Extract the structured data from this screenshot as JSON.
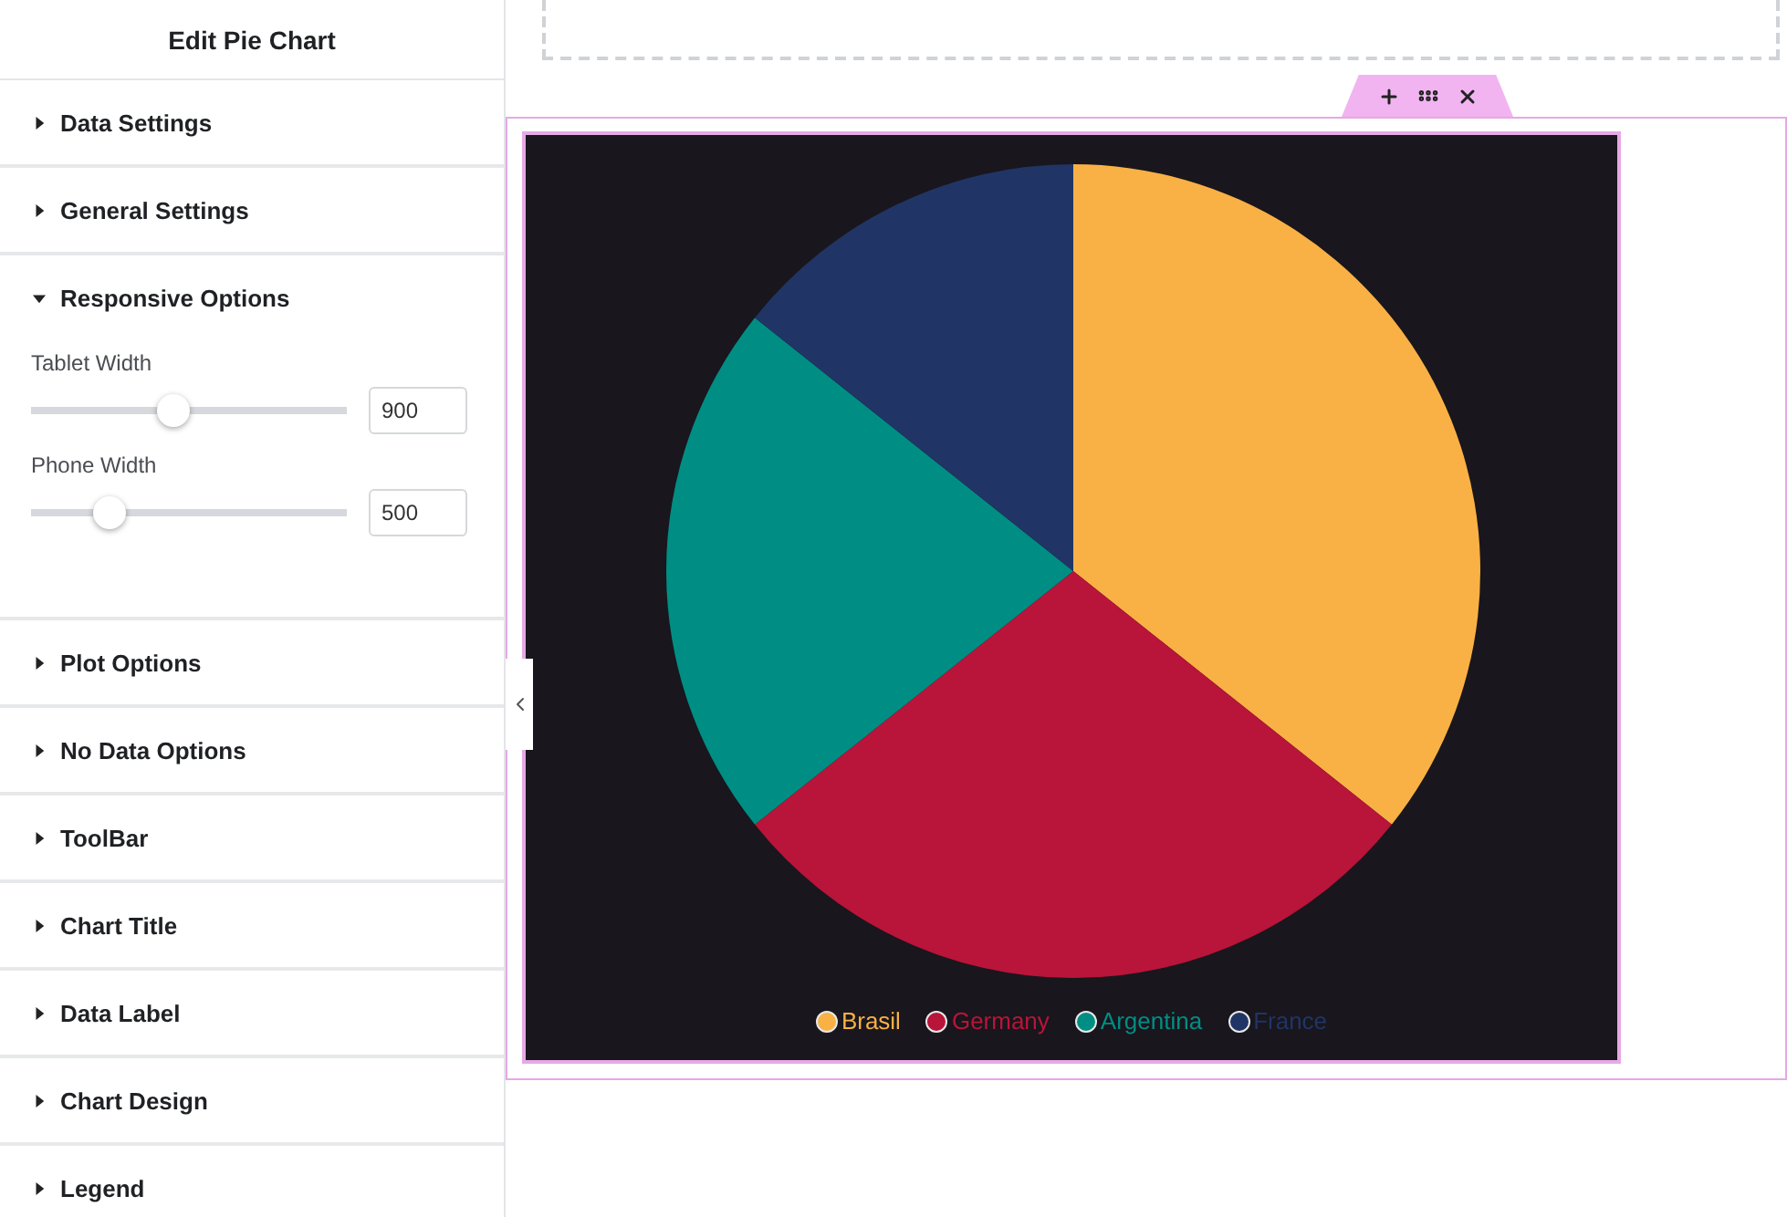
{
  "panel": {
    "title": "Edit Pie Chart"
  },
  "sections": [
    {
      "label": "Data Settings",
      "expanded": false
    },
    {
      "label": "General Settings",
      "expanded": false
    },
    {
      "label": "Responsive Options",
      "expanded": true,
      "controls": [
        {
          "label": "Tablet Width",
          "level": 0.45,
          "value": "900"
        },
        {
          "label": "Phone Width",
          "level": 0.25,
          "value": "500"
        }
      ]
    },
    {
      "label": "Plot Options",
      "expanded": false
    },
    {
      "label": "No Data Options",
      "expanded": false
    },
    {
      "label": "ToolBar",
      "expanded": false
    },
    {
      "label": "Chart Title",
      "expanded": false
    },
    {
      "label": "Data Label",
      "expanded": false
    },
    {
      "label": "Chart Design",
      "expanded": false
    },
    {
      "label": "Legend",
      "expanded": false
    }
  ],
  "chart": {
    "chart_data": {
      "type": "pie",
      "categories": [
        "Brasil",
        "Germany",
        "Argentina",
        "France"
      ],
      "values": [
        35.7,
        28.6,
        21.4,
        14.3
      ],
      "colors": [
        "#f9b145",
        "#b91439",
        "#008e84",
        "#203565"
      ]
    }
  }
}
